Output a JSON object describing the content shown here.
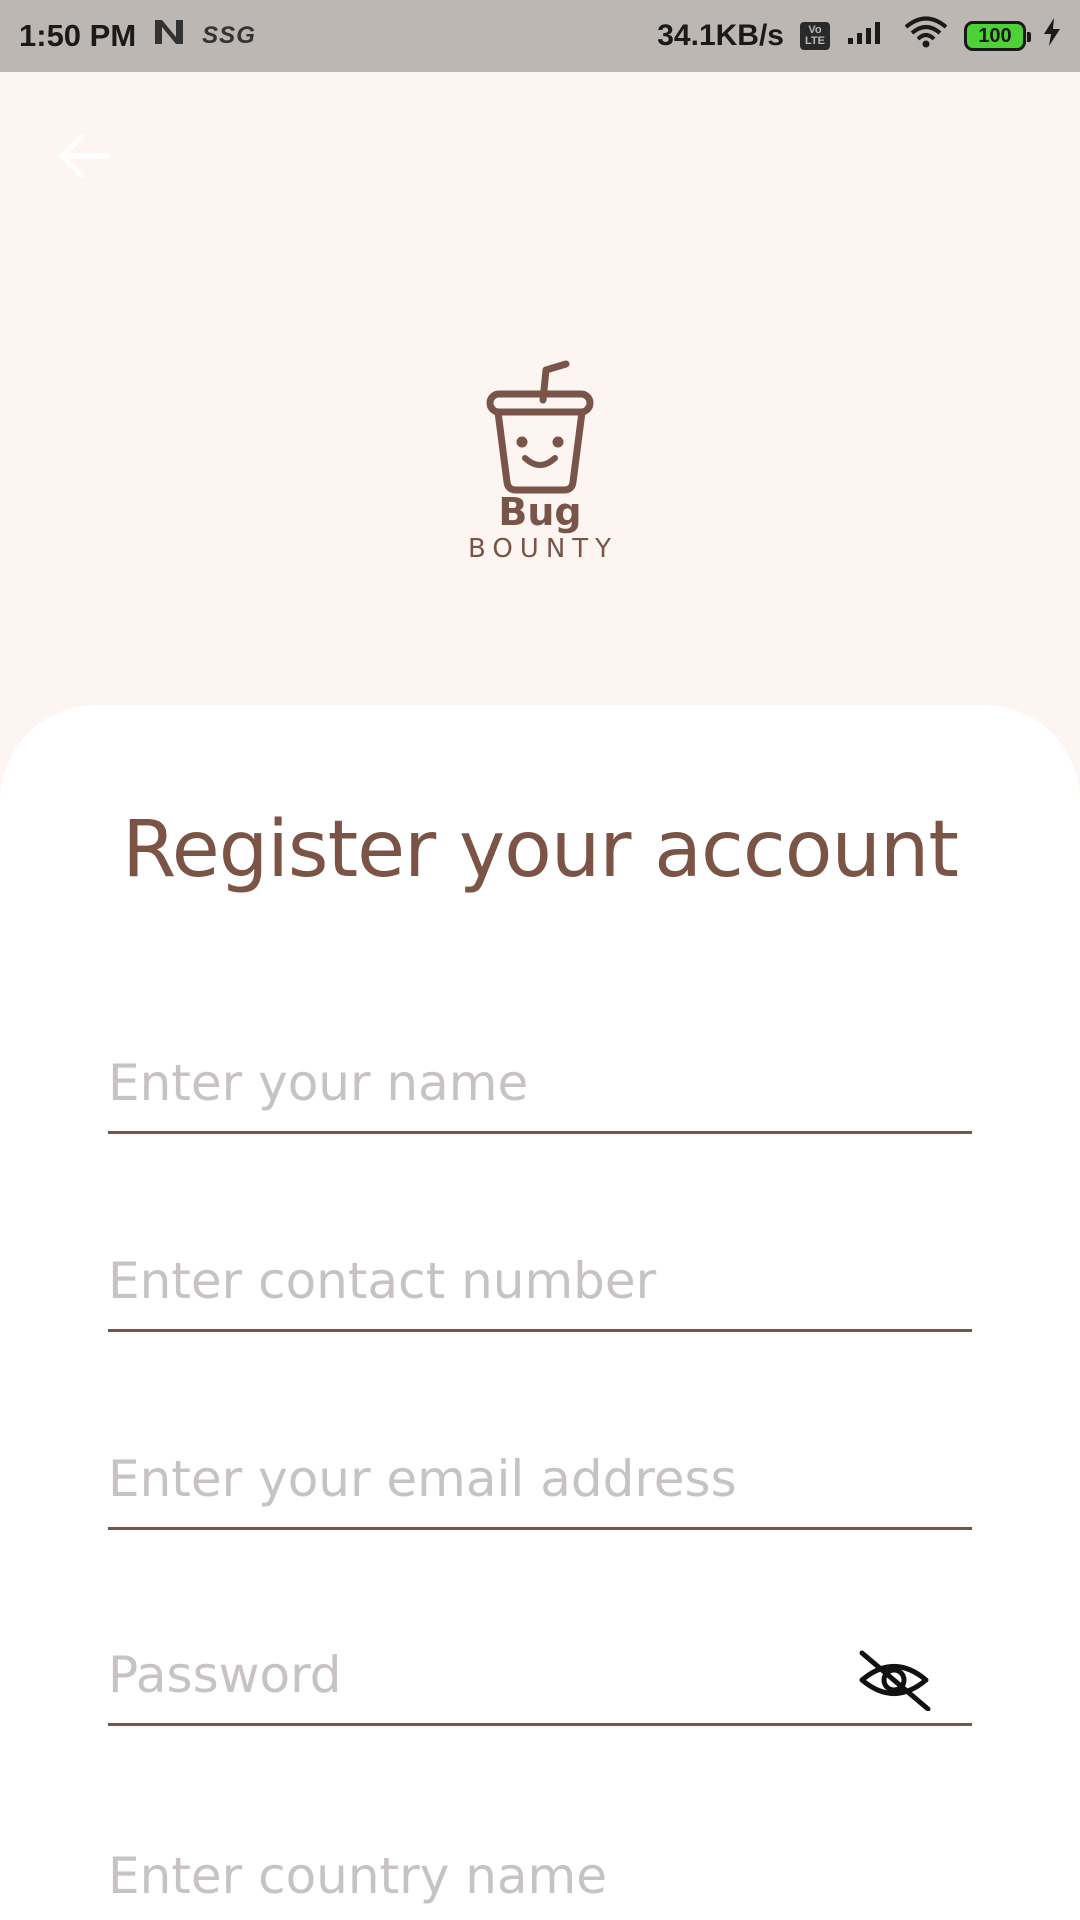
{
  "status_bar": {
    "time": "1:50 PM",
    "carrier_badge": "SSG",
    "net_speed": "34.1KB/s",
    "volte_top": "Vo",
    "volte_bottom": "LTE",
    "battery": "100",
    "icons": [
      "n-icon",
      "volte-icon",
      "signal-icon",
      "wifi-icon",
      "battery-icon",
      "charging-icon"
    ]
  },
  "header": {
    "back_icon": "arrow-left-icon",
    "logo": {
      "line1": "Bug",
      "line2": "BOUNTY",
      "icon": "cup-smiley-icon"
    }
  },
  "form": {
    "title": "Register your account",
    "fields": [
      {
        "placeholder": "Enter your name",
        "type": "text"
      },
      {
        "placeholder": "Enter contact number",
        "type": "tel"
      },
      {
        "placeholder": "Enter your email address",
        "type": "email"
      },
      {
        "placeholder": "Password",
        "type": "password",
        "toggle_icon": "eye-off-icon"
      },
      {
        "placeholder": "Enter country name",
        "type": "text"
      }
    ]
  },
  "colors": {
    "accent": "#7b5446",
    "header_bg": "#fdf5f1",
    "status_bar_bg": "#bdb7b4",
    "placeholder": "#c7c3c2"
  }
}
